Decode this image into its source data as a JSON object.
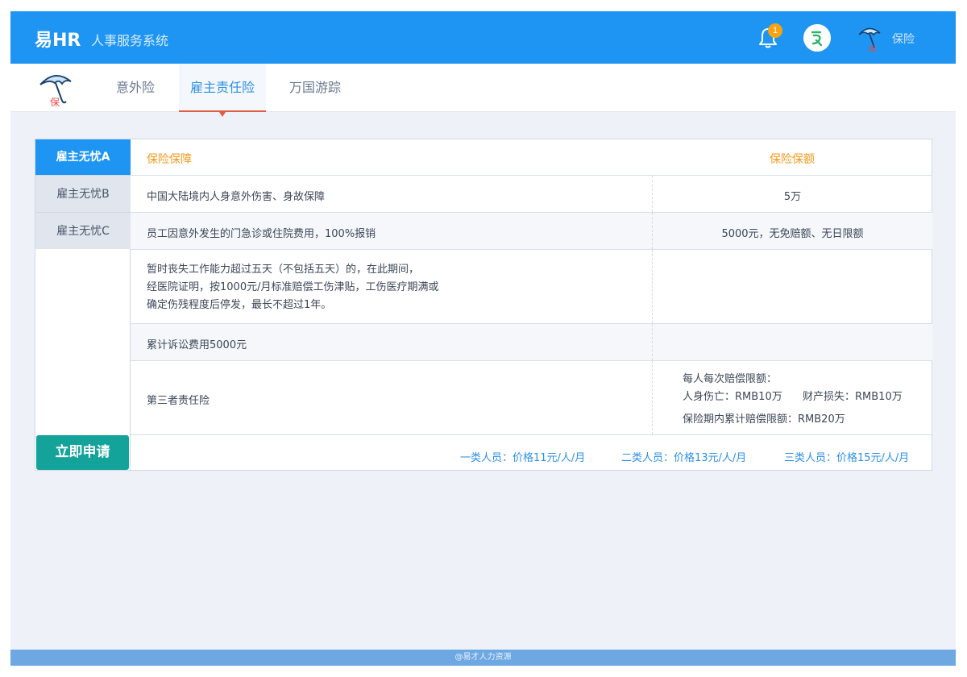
{
  "header": {
    "logo": "易HR",
    "subtitle": "人事服务系统",
    "notification_count": "1",
    "user_name": "保险",
    "accent": "#1f95f3"
  },
  "tabs": [
    {
      "label": "意外险",
      "active": false
    },
    {
      "label": "雇主责任险",
      "active": true
    },
    {
      "label": "万国游踪",
      "active": false
    }
  ],
  "plans": [
    "雇主无忧A",
    "雇主无忧B",
    "雇主无忧C"
  ],
  "table": {
    "col1_header": "保险保障",
    "col2_header": "保险保额",
    "rows": [
      {
        "coverage": "中国大陆境内人身意外伤害、身故保障",
        "amount": "5万"
      },
      {
        "coverage": "员工因意外发生的门急诊或住院费用，100%报销",
        "amount": "5000元，无免赔额、无日限额"
      },
      {
        "coverage_lines": [
          "暂时丧失工作能力超过五天（不包括五天）的，在此期间，",
          "经医院证明，按1000元/月标准赔偿工伤津贴，工伤医疗期满或",
          "确定伤残程度后停发，最长不超过1年。"
        ],
        "amount": ""
      },
      {
        "coverage": "累计诉讼费用5000元",
        "amount": ""
      },
      {
        "coverage": "第三者责任险",
        "amount_lines": [
          "每人每次赔偿限额：",
          "人身伤亡：RMB10万",
          "财产损失：RMB10万",
          "保险期内累计赔偿限额：RMB20万"
        ]
      }
    ]
  },
  "apply_button": "立即申请",
  "prices": [
    "一类人员：价格11元/人/月",
    "二类人员：价格13元/人/月",
    "三类人员：价格15元/人/月"
  ],
  "footer": "@易才人力资源",
  "icons": {
    "bell": "bell-icon",
    "app": "app-logo-icon",
    "user": "umbrella-insurance-icon"
  }
}
